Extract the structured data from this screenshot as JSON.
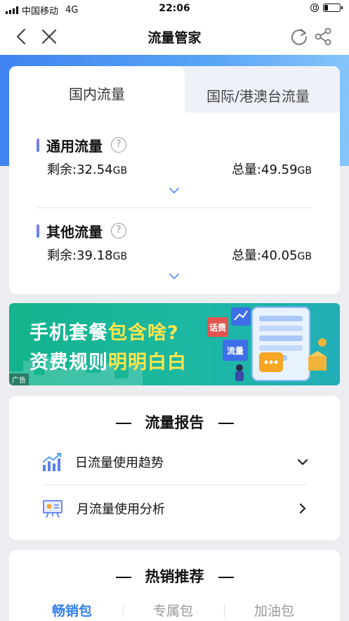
{
  "status_bar": {
    "carrier": "中国移动",
    "network": "4G",
    "time": "22:06"
  },
  "nav": {
    "title": "流量管家",
    "back_icon": "back-chevron-icon",
    "close_icon": "close-icon",
    "refresh_icon": "refresh-icon",
    "share_icon": "share-icon"
  },
  "colors": {
    "accent": "#2f7ef2",
    "header_gradient_start": "#3f83f1",
    "header_gradient_end": "#86c4fb",
    "ad_background": "#1cb8a2",
    "ad_highlight": "#ffe44c"
  },
  "tabs": {
    "domestic": "国内流量",
    "international": "国际/港澳台流量"
  },
  "sections": [
    {
      "title": "通用流量",
      "remaining_label": "剩余:",
      "remaining_value": "32.54",
      "remaining_unit": "GB",
      "total_label": "总量:",
      "total_value": "49.59",
      "total_unit": "GB"
    },
    {
      "title": "其他流量",
      "remaining_label": "剩余:",
      "remaining_value": "39.18",
      "remaining_unit": "GB",
      "total_label": "总量:",
      "total_value": "40.05",
      "total_unit": "GB"
    }
  ],
  "ad": {
    "line1_prefix": "手机套餐",
    "line1_highlight": "包含啥?",
    "line2_prefix": "资费规则",
    "line2_highlight": "明明白白",
    "tag_topup": "话费",
    "tag_flow": "流量",
    "badge": "广告"
  },
  "report": {
    "title": "流量报告",
    "items": [
      {
        "label": "日流量使用趋势",
        "icon": "bar-chart-trend-icon",
        "arrow": "chevron-down-icon"
      },
      {
        "label": "月流量使用分析",
        "icon": "presentation-board-icon",
        "arrow": "chevron-right-icon"
      }
    ]
  },
  "hot": {
    "title": "热销推荐",
    "tabs": [
      "畅销包",
      "专属包",
      "加油包"
    ],
    "active_tab": 0
  }
}
